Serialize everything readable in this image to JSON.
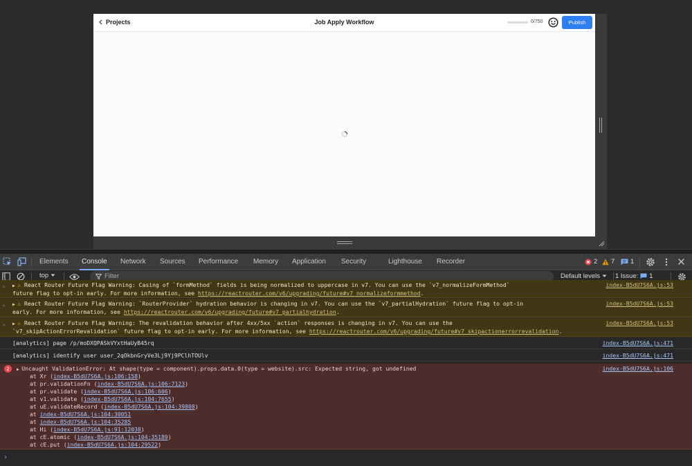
{
  "app": {
    "back_label": "Projects",
    "page_title": "Job Apply Workflow",
    "char_count": "0/750",
    "progress_fraction": 0.0,
    "publish_label": "Publish",
    "accent": "#2f7ff0"
  },
  "devtools": {
    "tabs": [
      "Elements",
      "Console",
      "Network",
      "Sources",
      "Performance",
      "Memory",
      "Application",
      "Security",
      "Lighthouse",
      "Recorder"
    ],
    "active_tab": "Console",
    "error_count": "2",
    "warning_count": "7",
    "info_count": "1",
    "context_select": "top",
    "filter_placeholder": "Filter",
    "levels_select": "Default levels",
    "issues_label": "1 Issue:",
    "issues_count": "1"
  },
  "console": {
    "warnings": [
      {
        "line1_pre": "React Router Future Flag Warning: Casing of `formMethod` fields is being normalized to uppercase in v7. You can use the `v7_normalizeFormMethod`",
        "line2_pre": "future flag to opt-in early. For more information, see ",
        "link": "https://reactrouter.com/v6/upgrading/future#v7_normalizeformmethod",
        "line2_post": ".",
        "source": "index-B5dU7S6A.js:53"
      },
      {
        "line1_pre": "React Router Future Flag Warning: `RouterProvider` hydration behavior is changing in v7. You can use the `v7_partialHydration` future flag to opt-in",
        "line2_pre": "early. For more information, see ",
        "link": "https://reactrouter.com/v6/upgrading/future#v7_partialhydration",
        "line2_post": ".",
        "source": "index-B5dU7S6A.js:53"
      },
      {
        "line1_pre": "React Router Future Flag Warning: The revalidation behavior after 4xx/5xx `action` responses is changing in v7. You can use the",
        "line2_pre": "`v7_skipActionErrorRevalidation` future flag to opt-in early. For more information, see ",
        "link": "https://reactrouter.com/v6/upgrading/future#v7_skipactionerrorrevalidation",
        "line2_post": ".",
        "source": "index-B5dU7S6A.js:53"
      }
    ],
    "logs": [
      {
        "text": "[analytics] page /p/moDXQPASkVYxtHaUyB45rq",
        "source": "index-B5dU7S6A.js:471"
      },
      {
        "text": "[analytics] identify user user_2qOkbnGryVe3Lj9Yj9PClhTOUlv",
        "source": "index-B5dU7S6A.js:471"
      }
    ],
    "error": {
      "badge": "2",
      "message": "Uncaught ValidationError: At shape(type = component).props.data.0(type = website).src: Expected string, got undefined",
      "source": "index-B5dU7S6A.js:106",
      "stack": [
        {
          "pre": "at Xr (",
          "link": "index-B5dU7S6A.js:106:158",
          "post": ")"
        },
        {
          "pre": "at pr.validationFn (",
          "link": "index-B5dU7S6A.js:106:7123",
          "post": ")"
        },
        {
          "pre": "at pr.validate (",
          "link": "index-B5dU7S6A.js:106:606",
          "post": ")"
        },
        {
          "pre": "at v1.validate (",
          "link": "index-B5dU7S6A.js:104:7655",
          "post": ")"
        },
        {
          "pre": "at uE.validateRecord (",
          "link": "index-B5dU7S6A.js:104:39808",
          "post": ")"
        },
        {
          "pre": "at ",
          "link": "index-B5dU7S6A.js:104:30051",
          "post": ""
        },
        {
          "pre": "at ",
          "link": "index-B5dU7S6A.js:104:35285",
          "post": ""
        },
        {
          "pre": "at Hi (",
          "link": "index-B5dU7S6A.js:91:12038",
          "post": ")"
        },
        {
          "pre": "at cE.atomic (",
          "link": "index-B5dU7S6A.js:104:35189",
          "post": ")"
        },
        {
          "pre": "at cE.put (",
          "link": "index-B5dU7S6A.js:104:29522",
          "post": ")"
        }
      ]
    },
    "prompt": "›"
  }
}
